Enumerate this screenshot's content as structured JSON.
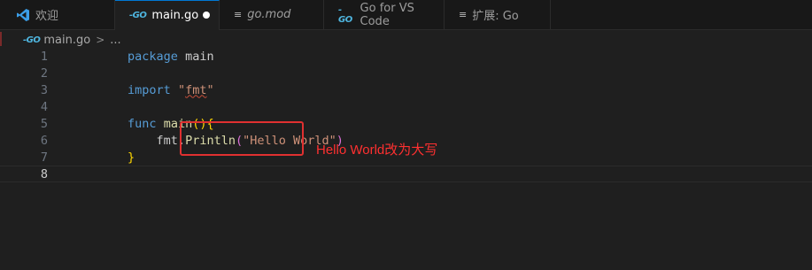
{
  "tabs": {
    "welcome": {
      "label": "欢迎",
      "icon": "vscode-icon"
    },
    "main": {
      "label": "main.go",
      "icon": "go-icon",
      "icon_text": "-GO",
      "dirty": true
    },
    "gomod": {
      "label": "go.mod",
      "icon": "lines-icon",
      "icon_text": "≡"
    },
    "vscode": {
      "label": "Go for VS Code",
      "icon": "go-icon",
      "icon_text": "-GO"
    },
    "ext": {
      "label": "扩展: Go",
      "icon": "lines-icon",
      "icon_text": "≡"
    }
  },
  "breadcrumb": {
    "icon_text": "-GO",
    "file": "main.go",
    "separator": ">",
    "ellipsis": "..."
  },
  "editor": {
    "line_numbers": [
      "1",
      "2",
      "3",
      "4",
      "5",
      "6",
      "7",
      "8"
    ],
    "current_line": "8",
    "code": {
      "l1_kw": "package",
      "l1_rest": " main",
      "l3_kw": "import",
      "l3_q1": " \"",
      "l3_pkg": "fmt",
      "l3_q2": "\"",
      "l5_kw": "func",
      "l5_sp": " ",
      "l5_fn": "main",
      "l5_parens": "()",
      "l5_brace": "{",
      "l6_indent": "    ",
      "l6_obj": "fmt.",
      "l6_fn": "Println",
      "l6_open": "(",
      "l6_str": "\"Hello World\"",
      "l6_close": ")",
      "l7_brace": "}"
    }
  },
  "annotation": {
    "text": "Hello World改为大写",
    "color": "#e03030"
  },
  "colors": {
    "accent": "#0078d4",
    "keyword": "#569cd6",
    "function": "#dcdcaa",
    "string": "#ce9178",
    "brace": "#ffd700"
  }
}
